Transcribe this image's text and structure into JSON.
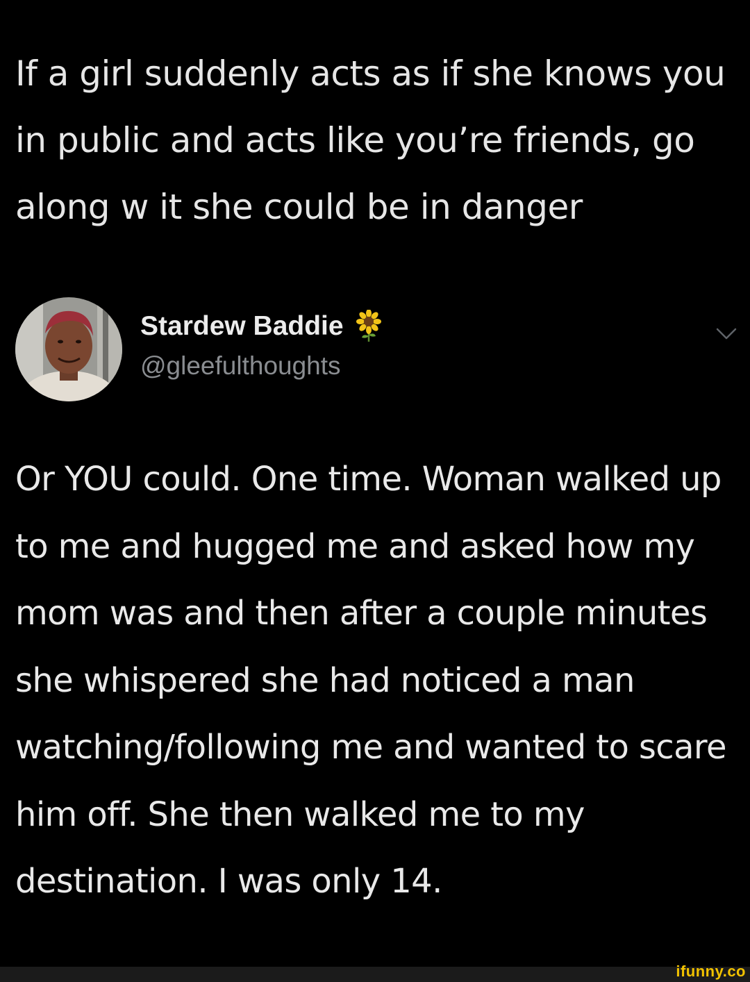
{
  "quoted_tweet": {
    "text": "If a girl suddenly acts as if she knows you in public and acts like you’re friends, go along w it she could be in danger"
  },
  "author": {
    "display_name": "Stardew Baddie",
    "handle": "@gleefulthoughts",
    "badge_icon": "sunflower-icon",
    "menu_icon": "chevron-down-icon"
  },
  "tweet": {
    "body": "Or YOU could. One time. Woman walked up to me and hugged me and asked how my mom was and then after a couple minutes she whispered she had noticed a man watching/following me and wanted to scare him off. She then walked me to my destination. I was only 14."
  },
  "watermark": {
    "text": "ifunny.co"
  },
  "colors": {
    "background": "#000000",
    "text": "#e9e9e9",
    "handle": "#8a8d91",
    "watermark": "#f2c200"
  }
}
